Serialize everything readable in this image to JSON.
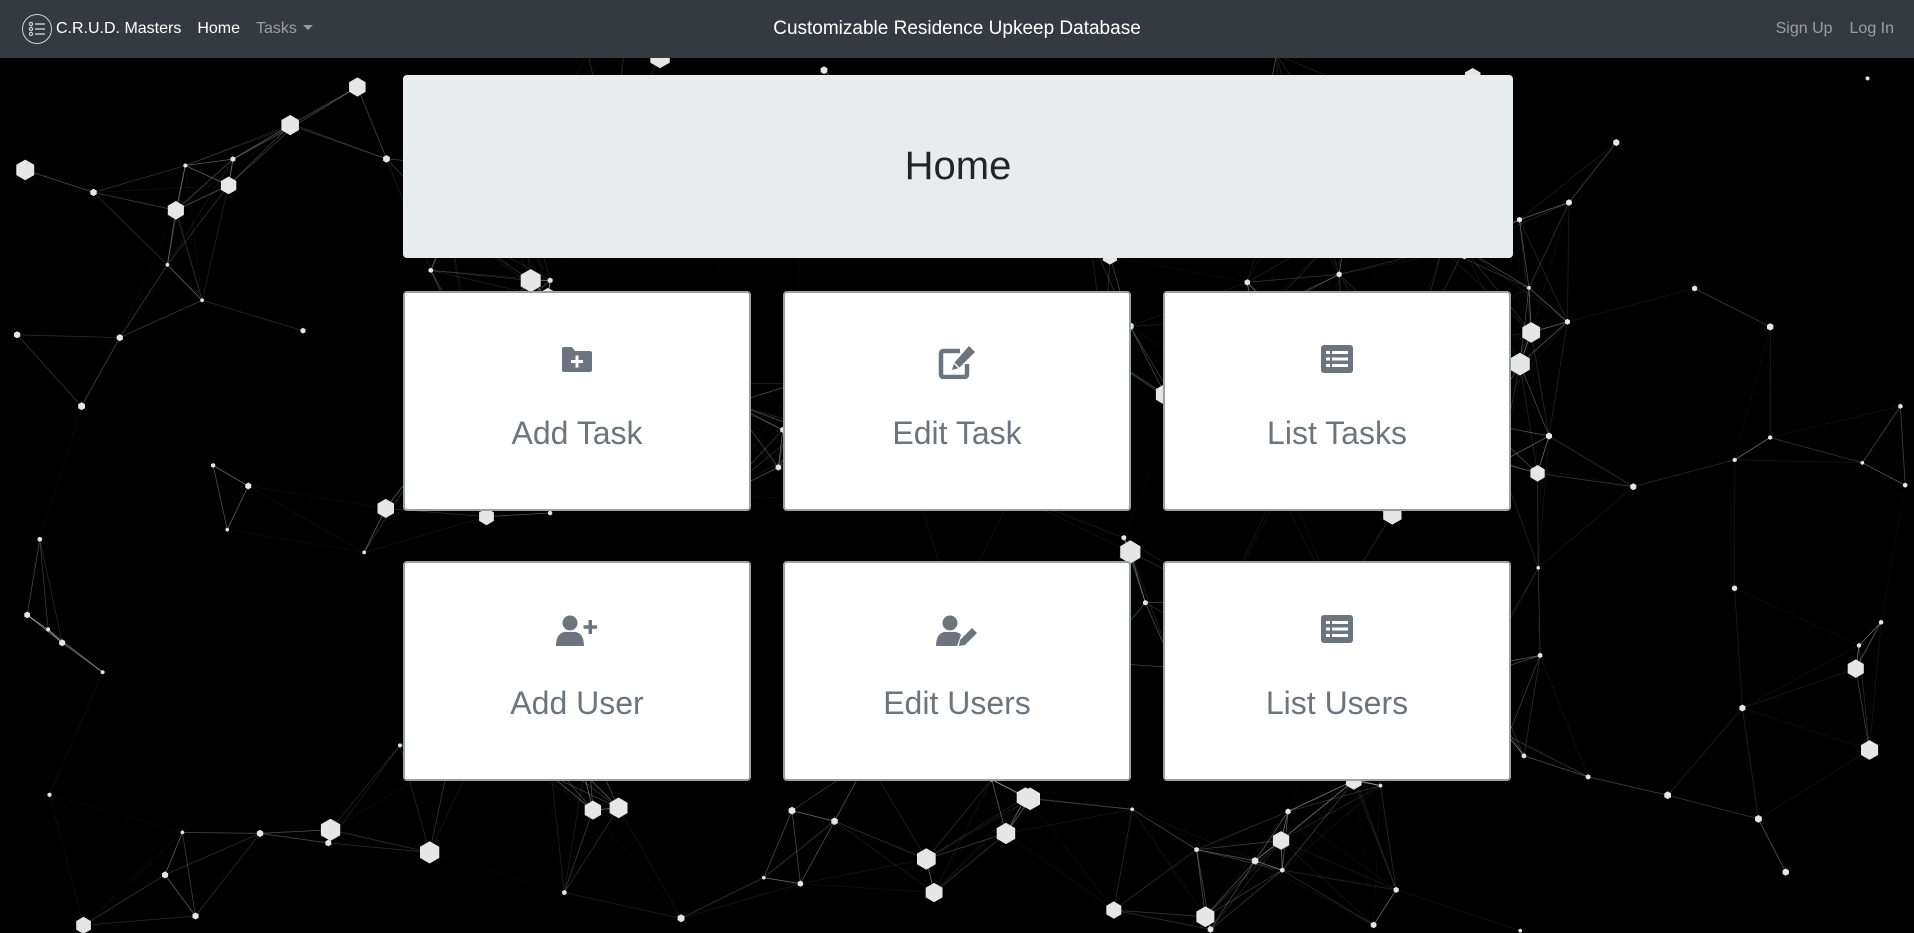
{
  "navbar": {
    "brand": "C.R.U.D. Masters",
    "brand_icon": "list-circle-icon",
    "home": "Home",
    "tasks": "Tasks",
    "title": "Customizable Residence Upkeep Database",
    "sign_up": "Sign Up",
    "log_in": "Log In"
  },
  "jumbotron": {
    "heading": "Home"
  },
  "cards": [
    {
      "label": "Add Task",
      "icon": "folder-plus-icon"
    },
    {
      "label": "Edit Task",
      "icon": "edit-icon"
    },
    {
      "label": "List Tasks",
      "icon": "list-icon"
    },
    {
      "label": "Add User",
      "icon": "user-plus-icon"
    },
    {
      "label": "Edit Users",
      "icon": "user-edit-icon"
    },
    {
      "label": "List Users",
      "icon": "list-icon"
    }
  ],
  "colors": {
    "navbar_bg": "#343a40",
    "jumbotron_bg": "#e9ecef",
    "card_text": "#6c757d",
    "page_bg": "#000000"
  }
}
